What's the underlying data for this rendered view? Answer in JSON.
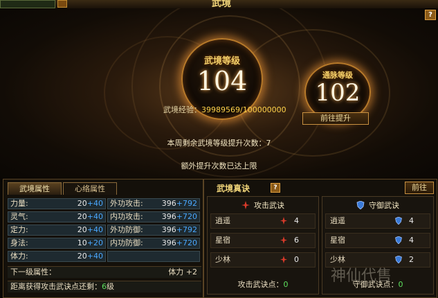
{
  "header": {
    "title": "武境",
    "help": "?"
  },
  "hero": {
    "wujing_label": "武境等级",
    "wujing_level": "104",
    "tongmai_label": "通脉等级",
    "tongmai_level": "102",
    "exp_label": "武境经验：",
    "exp_value": "39989569/100000000",
    "goto_button": "前往提升",
    "weekly_text": "本周剩余武境等级提升次数：7",
    "extra_text": "额外提升次数已达上限"
  },
  "left": {
    "tabs": [
      "武境属性",
      "心络属性"
    ],
    "attrs": [
      {
        "name": "力量:",
        "base": "20",
        "plus": "+40"
      },
      {
        "name": "灵气:",
        "base": "20",
        "plus": "+40"
      },
      {
        "name": "定力:",
        "base": "20",
        "plus": "+40"
      },
      {
        "name": "身法:",
        "base": "10",
        "plus": "+20"
      },
      {
        "name": "体力:",
        "base": "20",
        "plus": "+40"
      }
    ],
    "combat": [
      {
        "name": "外功攻击:",
        "base": "396",
        "plus": "+792"
      },
      {
        "name": "内功攻击:",
        "base": "396",
        "plus": "+720"
      },
      {
        "name": "外功防御:",
        "base": "396",
        "plus": "+792"
      },
      {
        "name": "内功防御:",
        "base": "396",
        "plus": "+720"
      }
    ],
    "next_label": "下一级属性：",
    "next_value": "体力 +2",
    "dist_prefix": "距离获得攻击武诀点还剩：",
    "dist_num": "6",
    "dist_suffix": "级"
  },
  "right": {
    "title": "武境真诀",
    "help": "?",
    "goto": "前往",
    "attack": {
      "title": "攻击武诀",
      "rows": [
        {
          "name": "逍遥",
          "count": "4"
        },
        {
          "name": "星宿",
          "count": "6"
        },
        {
          "name": "少林",
          "count": "0"
        }
      ],
      "points_label": "攻击武诀点：",
      "points": "0"
    },
    "defense": {
      "title": "守御武诀",
      "rows": [
        {
          "name": "逍遥",
          "count": "4"
        },
        {
          "name": "星宿",
          "count": "4"
        },
        {
          "name": "少林",
          "count": "2"
        }
      ],
      "points_label": "守御武诀点：",
      "points": "0"
    }
  },
  "watermark": "神仙代售",
  "colors": {
    "gold": "#f2d67a",
    "plus_blue": "#4aa8ff",
    "points_green": "#5ee05e"
  }
}
